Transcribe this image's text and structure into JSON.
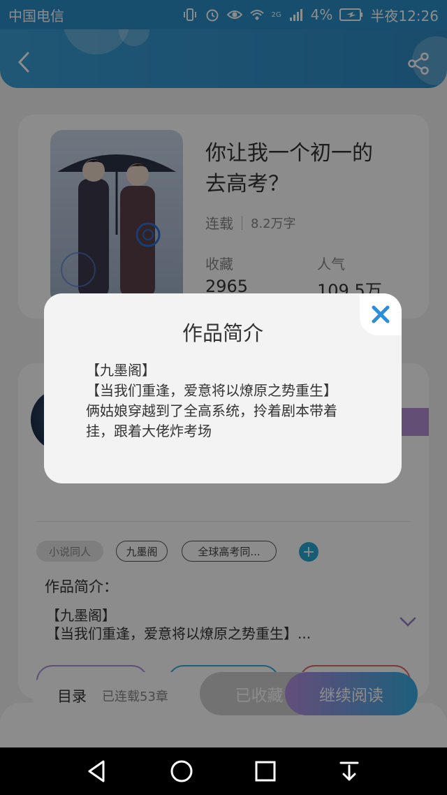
{
  "status_bar": {
    "carrier": "中国电信",
    "network": "2G",
    "battery": "4%",
    "time": "半夜12:26"
  },
  "header": {
    "back_icon": "chevron-left-icon",
    "share_icon": "share-icon"
  },
  "book": {
    "title_line1": "你让我一个初一的",
    "title_line2": "去高考？",
    "status": "连载",
    "word_count": "8.2万字",
    "favorites_label": "收藏",
    "favorites_value": "2965",
    "popularity_label": "人气",
    "popularity_value": "109.5万"
  },
  "detail": {
    "tags": [
      "小说同人",
      "九墨阁",
      "全球高考同..."
    ],
    "add_tag_icon": "plus-icon",
    "intro_heading": "作品简介：",
    "intro_line1": "【九墨阁】",
    "intro_line2": "【当我们重逢，爱意将以燎原之势重生】...",
    "expand_icon": "chevron-down-icon"
  },
  "bottom_bar": {
    "toc_label": "目录",
    "chapters_label": "已连载53章",
    "collected_label": "已收藏",
    "read_label": "继续阅读"
  },
  "modal": {
    "title": "作品简介",
    "lines": [
      "【九墨阁】",
      "【当我们重逢，爱意将以燎原之势重生】",
      "俩姑娘穿越到了全高系统，拎着剧本带着",
      "挂，跟着大佬炸考场"
    ],
    "close_icon": "close-icon"
  },
  "colors": {
    "accent_blue": "#2f8bc4",
    "close_blue": "#2a8fd8",
    "purple": "#b58fe0"
  }
}
